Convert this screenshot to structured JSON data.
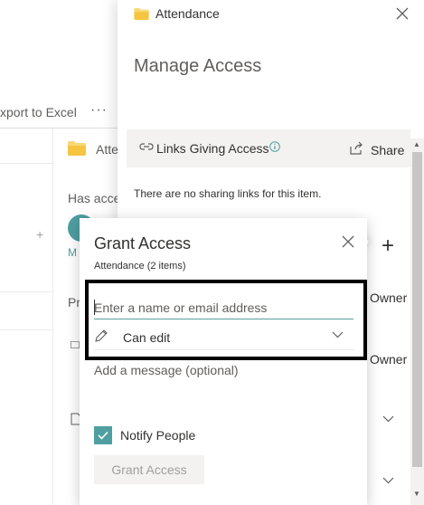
{
  "background": {
    "toolbar": {
      "export_label": "xport to Excel",
      "more_label": "···"
    },
    "detail": {
      "item_title": "Atte",
      "has_access_label": "Has acce",
      "avatar_initial": "M",
      "section_label": "Pr"
    }
  },
  "manage_access": {
    "breadcrumb": "Attendance",
    "title": "Manage Access",
    "links": {
      "label": "Links Giving Access",
      "share_label": "Share",
      "empty_text": "There are no sharing links for this item."
    },
    "owner_labels": [
      "Owner",
      "Owner"
    ]
  },
  "grant_access": {
    "title": "Grant Access",
    "subtitle": "Attendance (2 items)",
    "name_input": {
      "placeholder": "Enter a name or email address",
      "value": ""
    },
    "permission": "Can edit",
    "message_placeholder": "Add a message (optional)",
    "notify": {
      "label": "Notify People",
      "checked": true
    },
    "submit_label": "Grant Access"
  },
  "colors": {
    "accent": "#4f9ea1",
    "highlight_border": "#000000"
  },
  "icons": {
    "folder": "folder-icon",
    "close": "close-icon",
    "link": "link-icon",
    "info": "info-icon",
    "share": "share-icon",
    "pencil": "pencil-icon",
    "chevron": "chevron-down-icon",
    "check": "checkmark-icon",
    "plus": "plus-icon"
  }
}
